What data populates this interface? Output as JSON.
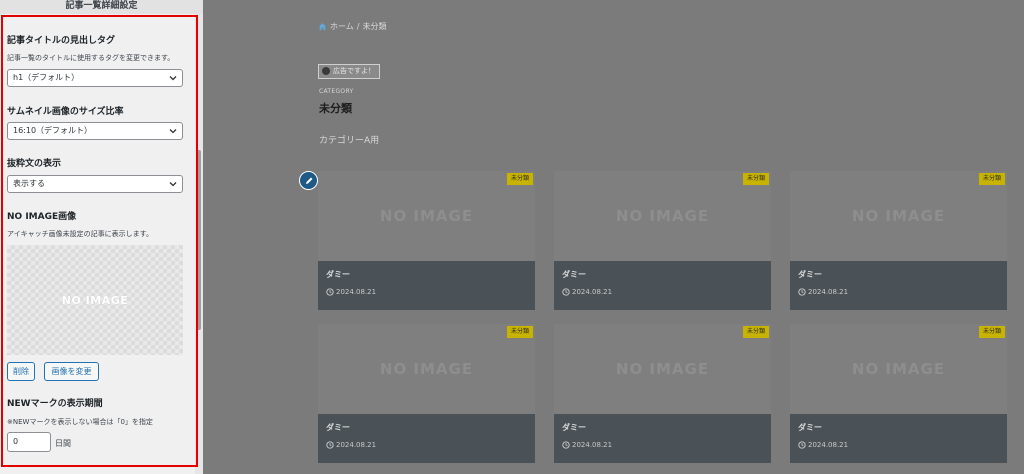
{
  "panel": {
    "header": "記事一覧詳細設定",
    "heading_tag": {
      "title": "記事タイトルの見出しタグ",
      "desc": "記事一覧のタイトルに使用するタグを変更できます。",
      "selected": "h1（デフォルト）"
    },
    "thumb_ratio": {
      "title": "サムネイル画像のサイズ比率",
      "selected": "16:10（デフォルト）"
    },
    "excerpt": {
      "title": "抜粋文の表示",
      "selected": "表示する"
    },
    "noimage": {
      "title": "NO IMAGE画像",
      "desc": "アイキャッチ画像未設定の記事に表示します。",
      "image_text": "NO IMAGE",
      "delete_button": "削除",
      "change_button": "画像を変更"
    },
    "new_mark": {
      "title": "NEWマークの表示期間",
      "desc": "※NEWマークを表示しない場合は「0」を指定",
      "value": "0",
      "unit": "日間"
    }
  },
  "preview": {
    "breadcrumb": {
      "home": "ホーム",
      "sep": "/",
      "current": "未分類"
    },
    "ad_label": "広告ですよ！",
    "category_label": "CATEGORY",
    "category_title": "未分類",
    "category_desc": "カテゴリーA用",
    "cards": [
      {
        "badge": "未分類",
        "image_text": "NO IMAGE",
        "title": "ダミー",
        "date": "2024.08.21"
      },
      {
        "badge": "未分類",
        "image_text": "NO IMAGE",
        "title": "ダミー",
        "date": "2024.08.21"
      },
      {
        "badge": "未分類",
        "image_text": "NO IMAGE",
        "title": "ダミー",
        "date": "2024.08.21"
      },
      {
        "badge": "未分類",
        "image_text": "NO IMAGE",
        "title": "ダミー",
        "date": "2024.08.21"
      },
      {
        "badge": "未分類",
        "image_text": "NO IMAGE",
        "title": "ダミー",
        "date": "2024.08.21"
      },
      {
        "badge": "未分類",
        "image_text": "NO IMAGE",
        "title": "ダミー",
        "date": "2024.08.21"
      }
    ]
  },
  "colors": {
    "highlight": "#e30000",
    "accent": "#2271b1",
    "badge": "#c8b400",
    "card_meta": "#4b5257"
  }
}
